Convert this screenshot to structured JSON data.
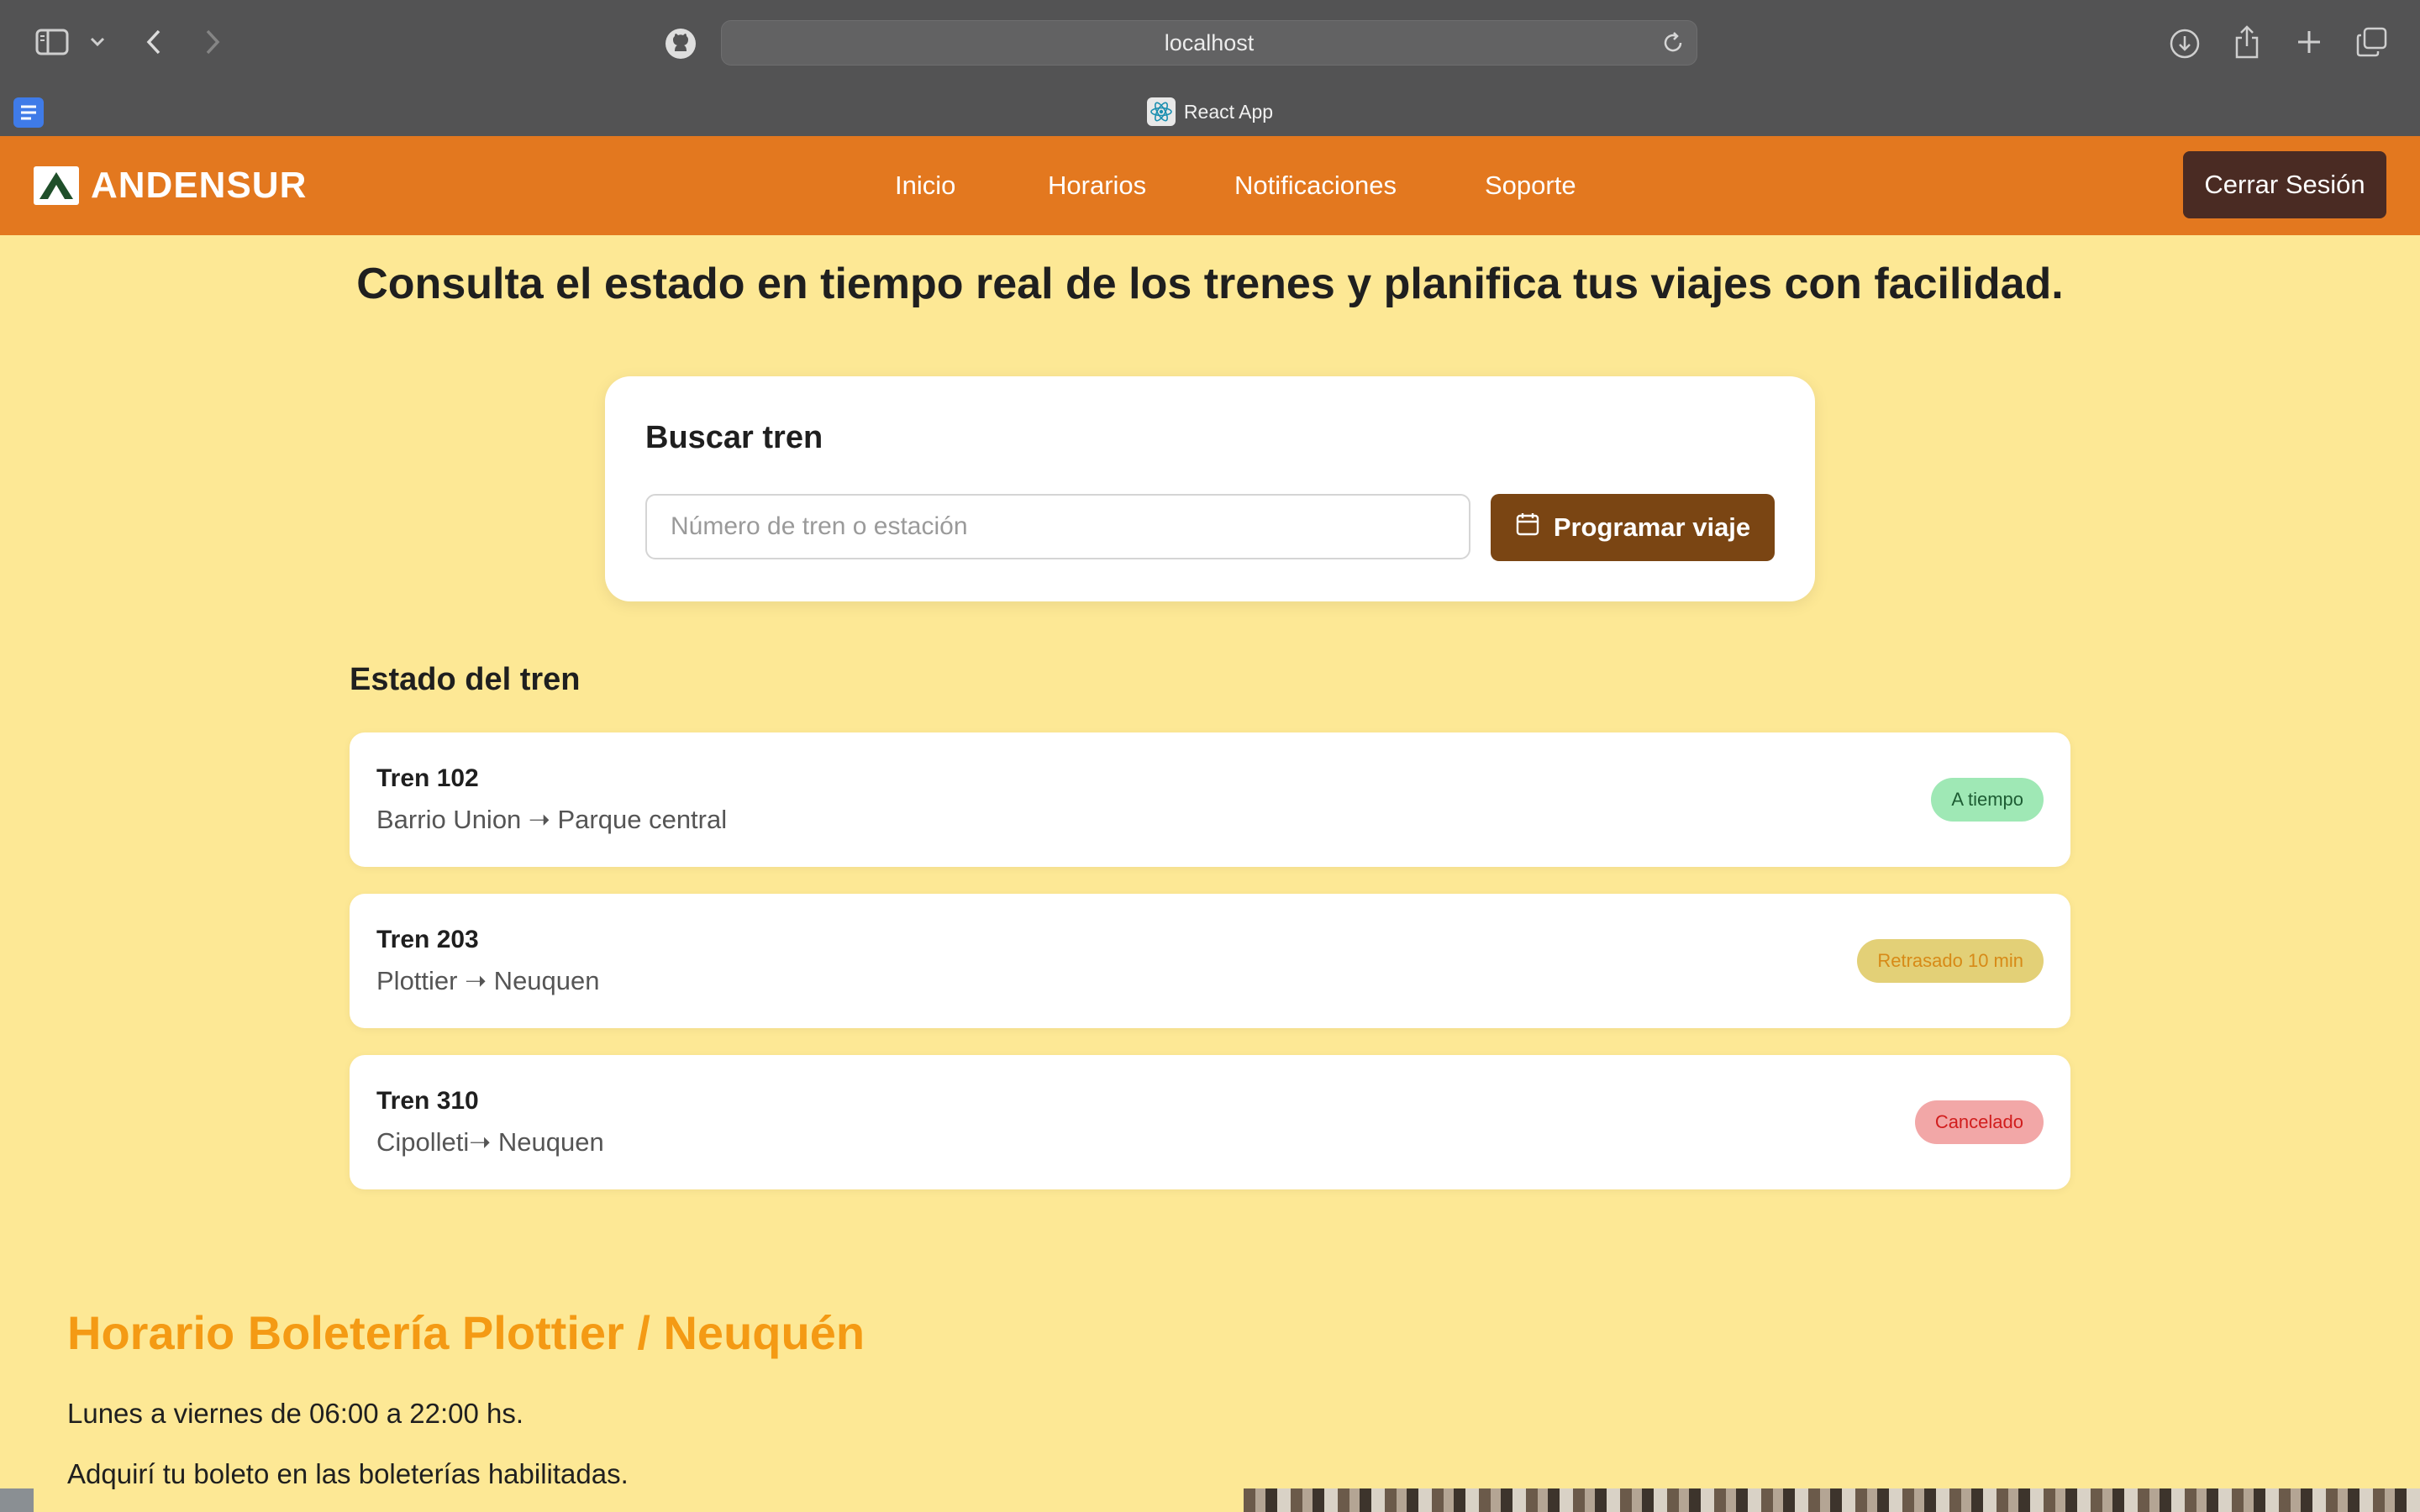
{
  "browser": {
    "url": "localhost",
    "tab_title": "React App"
  },
  "header": {
    "brand": "ANDENSUR",
    "nav": [
      "Inicio",
      "Horarios",
      "Notificaciones",
      "Soporte"
    ],
    "logout_label": "Cerrar Sesión",
    "colors": {
      "bar": "#e3781f",
      "logout": "#4a2b23"
    }
  },
  "main": {
    "headline": "Consulta el estado en tiempo real de los trenes y planifica tus viajes con facilidad.",
    "search": {
      "title": "Buscar tren",
      "placeholder": "Número de tren o estación",
      "value": "",
      "button_label": "Programar viaje",
      "button_icon": "calendar-icon"
    },
    "status_title": "Estado del tren",
    "trains": [
      {
        "name": "Tren 102",
        "route": "Barrio Union ➝ Parque central",
        "status": "A tiempo",
        "status_bg": "#9fe8b5",
        "status_color": "#1d5c33"
      },
      {
        "name": "Tren 203",
        "route": "Plottier ➝ Neuquen",
        "status": "Retrasado 10 min",
        "status_bg": "#e3d077",
        "status_color": "#d78a17"
      },
      {
        "name": "Tren 310",
        "route": "Cipolleti➝ Neuquen",
        "status": "Cancelado",
        "status_bg": "#f2a7a7",
        "status_color": "#d11e1e"
      }
    ]
  },
  "schedule": {
    "title": "Horario Boletería Plottier / Neuquén",
    "hours": "Lunes a viernes de 06:00 a 22:00 hs.",
    "note": "Adquirí tu boleto en las boleterías habilitadas.",
    "title_color": "#f49a14"
  }
}
